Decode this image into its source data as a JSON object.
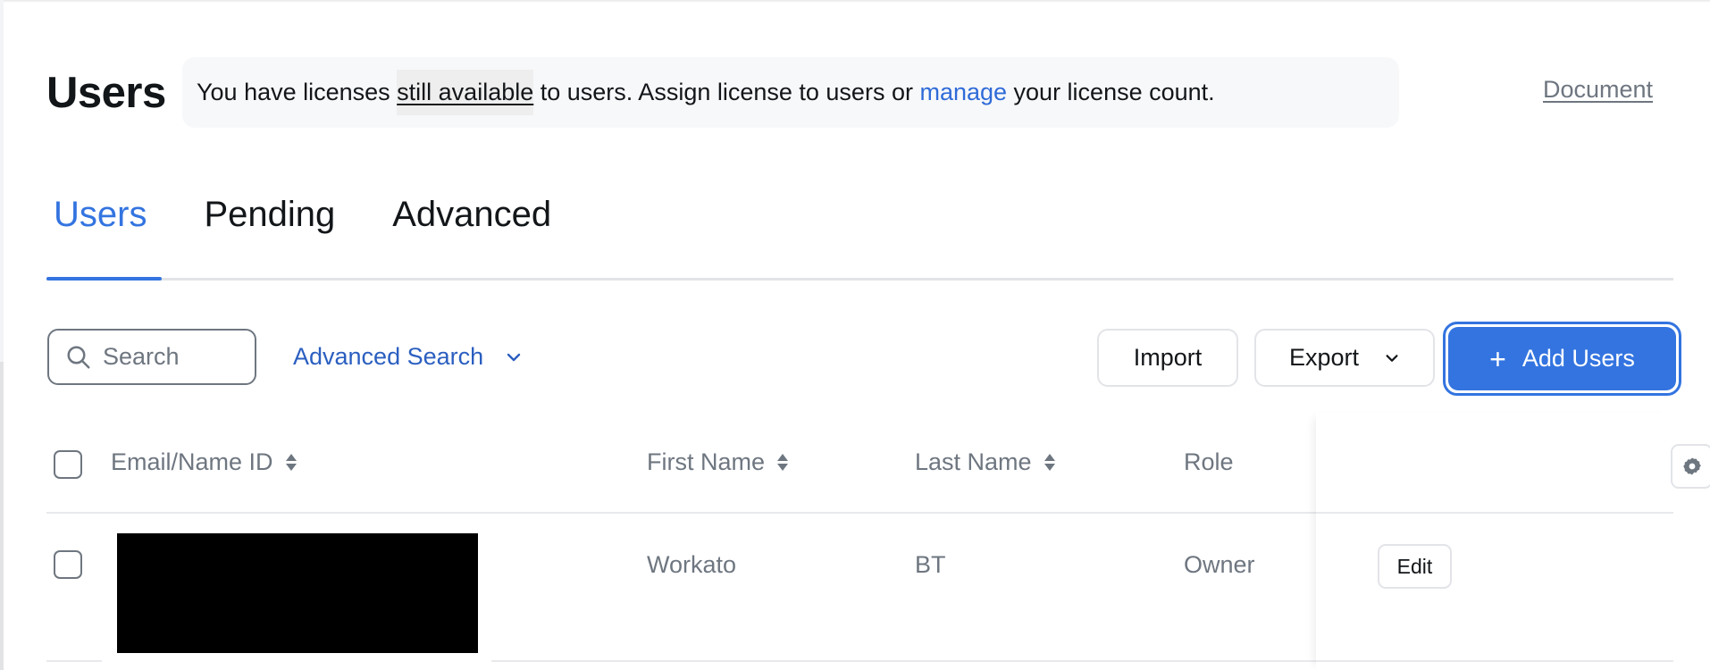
{
  "header": {
    "title": "Users",
    "banner": {
      "text_before": "You have licenses ",
      "highlight": "still available",
      "text_middle": " to users. Assign license to users or ",
      "link": "manage",
      "text_after": " your license count."
    },
    "document_link": "Document"
  },
  "tabs": [
    {
      "label": "Users",
      "active": true
    },
    {
      "label": "Pending",
      "active": false
    },
    {
      "label": "Advanced",
      "active": false
    }
  ],
  "toolbar": {
    "search_placeholder": "Search",
    "search_value": "",
    "advanced_search_label": "Advanced Search",
    "import_label": "Import",
    "export_label": "Export",
    "add_users_label": "Add Users",
    "add_users_icon": "plus-icon"
  },
  "table": {
    "columns": [
      {
        "label": "Email/Name ID",
        "sortable": true
      },
      {
        "label": "First Name",
        "sortable": true
      },
      {
        "label": "Last Name",
        "sortable": true
      },
      {
        "label": "Role",
        "sortable": false
      }
    ],
    "settings_icon": "gear-icon",
    "rows": [
      {
        "email": "[redacted]",
        "first_name": "Workato",
        "last_name": "BT",
        "role": "Owner",
        "action_label": "Edit",
        "checked": false
      }
    ]
  },
  "colors": {
    "accent": "#3374e0",
    "link": "#2b5fc0",
    "muted_text": "#6e7680",
    "banner_bg": "#f7f8fa"
  }
}
